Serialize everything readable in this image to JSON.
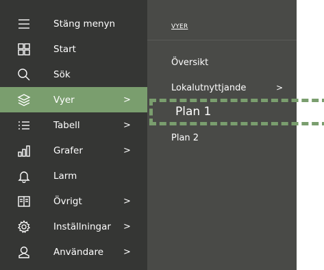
{
  "colors": {
    "nav_bg": "#353634",
    "submenu_bg": "#494a47",
    "active_bg": "#7a9e6e",
    "highlight_dash": "#7a9e6e",
    "text": "#ffffff"
  },
  "nav": {
    "items": [
      {
        "label": "Stäng menyn",
        "icon": "menu-icon",
        "chevron": "",
        "active": false
      },
      {
        "label": "Start",
        "icon": "grid-icon",
        "chevron": "",
        "active": false
      },
      {
        "label": "Sök",
        "icon": "search-icon",
        "chevron": "",
        "active": false
      },
      {
        "label": "Vyer",
        "icon": "layers-icon",
        "chevron": ">",
        "active": true
      },
      {
        "label": "Tabell",
        "icon": "list-icon",
        "chevron": ">",
        "active": false
      },
      {
        "label": "Grafer",
        "icon": "bar-chart-icon",
        "chevron": ">",
        "active": false
      },
      {
        "label": "Larm",
        "icon": "bell-icon",
        "chevron": "",
        "active": false
      },
      {
        "label": "Övrigt",
        "icon": "book-icon",
        "chevron": ">",
        "active": false
      },
      {
        "label": "Inställningar",
        "icon": "gear-icon",
        "chevron": ">",
        "active": false
      },
      {
        "label": "Användare",
        "icon": "user-icon",
        "chevron": ">",
        "active": false
      }
    ]
  },
  "submenu": {
    "header": "VYER",
    "items": [
      {
        "label": "Översikt",
        "chevron": ""
      },
      {
        "label": "Lokalutnyttjande",
        "chevron": ">"
      },
      {
        "label": "Plan 1",
        "chevron": "",
        "highlighted": true
      },
      {
        "label": "Plan 2",
        "chevron": ""
      }
    ]
  }
}
